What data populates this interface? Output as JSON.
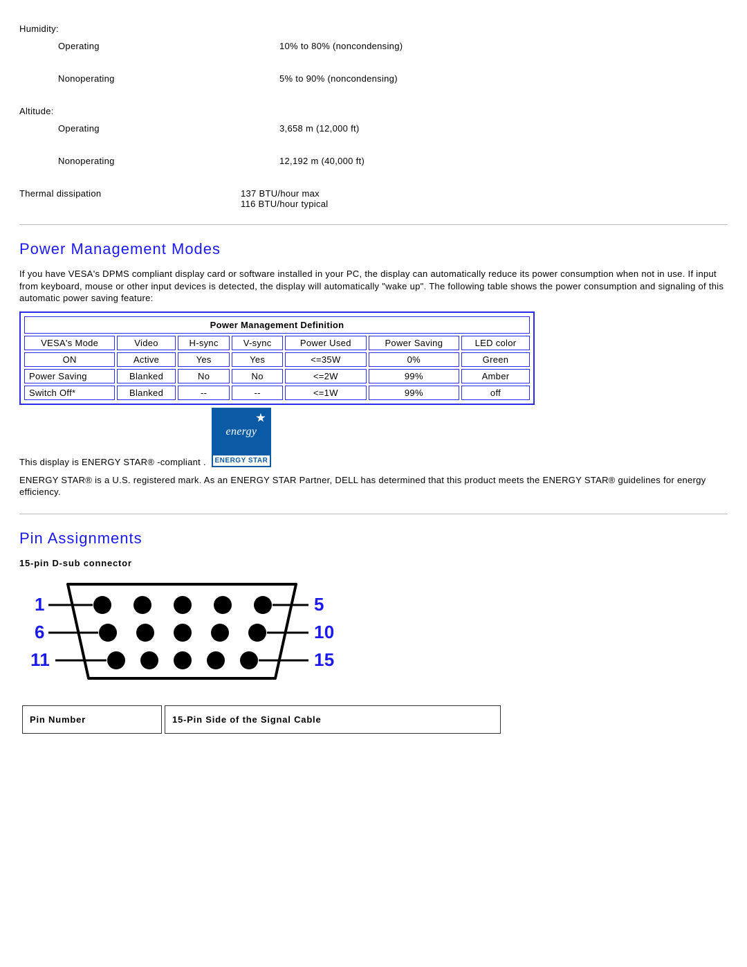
{
  "specs": {
    "humidity_label": "Humidity:",
    "altitude_label": "Altitude:",
    "rows": {
      "hum_op_l": "Operating",
      "hum_op_v": "10% to 80% (noncondensing)",
      "hum_non_l": "Nonoperating",
      "hum_non_v": "5% to 90% (noncondensing)",
      "alt_op_l": "Operating",
      "alt_op_v": "3,658 m (12,000 ft)",
      "alt_non_l": "Nonoperating",
      "alt_non_v": "12,192 m (40,000 ft)",
      "therm_l": "Thermal dissipation",
      "therm_v1": "137 BTU/hour max",
      "therm_v2": "116 BTU/hour typical"
    }
  },
  "pm": {
    "heading": "Power Management Modes",
    "intro": "If you have VESA's DPMS compliant display card or software installed in your PC, the display can automatically reduce its power consumption when not in use. If input from keyboard, mouse or other input devices is detected, the display will automatically \"wake up\". The following table shows the power consumption and signaling of this automatic power saving feature:",
    "caption": "Power Management Definition",
    "headers": {
      "mode": "VESA's Mode",
      "video": "Video",
      "hsync": "H-sync",
      "vsync": "V-sync",
      "power_used": "Power Used",
      "power_saving": "Power Saving",
      "led": "LED color"
    },
    "rows": [
      {
        "mode": "ON",
        "video": "Active",
        "hsync": "Yes",
        "vsync": "Yes",
        "power_used": "<=35W",
        "power_saving": "0%",
        "led": "Green"
      },
      {
        "mode": "Power Saving",
        "video": "Blanked",
        "hsync": "No",
        "vsync": "No",
        "power_used": "<=2W",
        "power_saving": "99%",
        "led": "Amber"
      },
      {
        "mode": "Switch Off*",
        "video": "Blanked",
        "hsync": "--",
        "vsync": "--",
        "power_used": "<=1W",
        "power_saving": "99%",
        "led": "off"
      }
    ]
  },
  "estar": {
    "line1": "This display is ENERGY STAR® -compliant .",
    "badge_script": "energy",
    "badge_label": "ENERGY STAR",
    "para": "ENERGY STAR®  is a U.S. registered mark. As an ENERGY STAR  Partner, DELL has determined that this product meets the ENERGY STAR®  guidelines for energy efficiency."
  },
  "pins": {
    "heading": "Pin Assignments",
    "connector_label": "15-pin D-sub connector",
    "labels": {
      "l1": "1",
      "r1": "5",
      "l2": "6",
      "r2": "10",
      "l3": "11",
      "r3": "15"
    },
    "table": {
      "h1": "Pin Number",
      "h2": "15-Pin Side of the Signal Cable"
    }
  }
}
